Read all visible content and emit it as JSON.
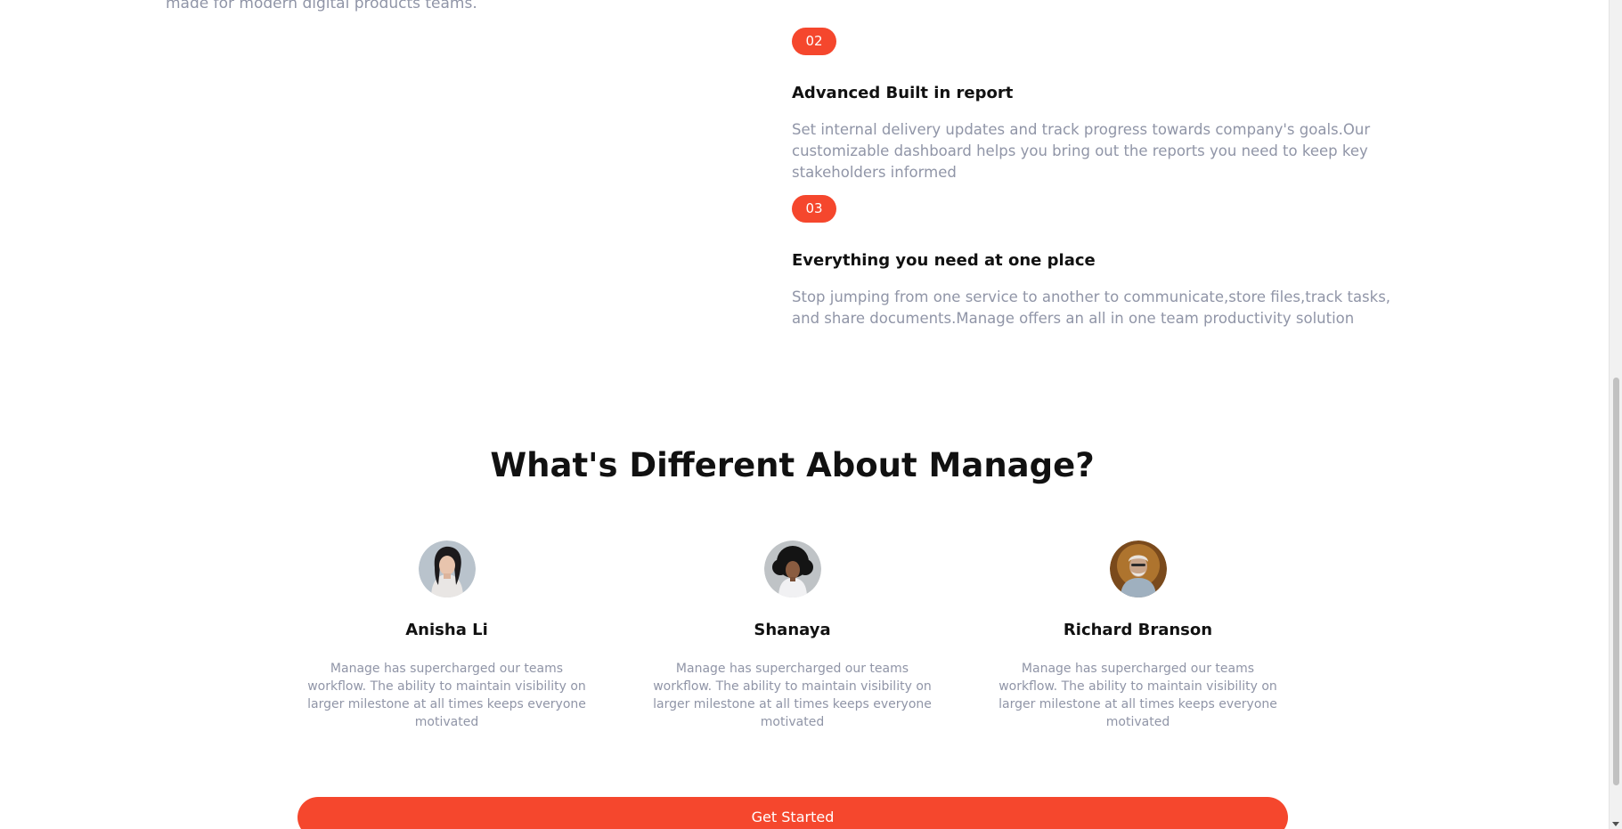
{
  "intro": {
    "tail_text": "made for modern digital products teams."
  },
  "features": [
    {
      "number": "02",
      "title": "Advanced Built in report",
      "text": "Set internal delivery updates and track progress towards company's goals.Our customizable dashboard helps you bring out the reports you need to keep key stakeholders informed"
    },
    {
      "number": "03",
      "title": "Everything you need at one place",
      "text": "Stop jumping from one service to another to communicate,store files,track tasks, and share documents.Manage offers an all in one team productivity solution"
    }
  ],
  "testimonials_section": {
    "title": "What's Different About Manage?",
    "items": [
      {
        "name": "Anisha Li",
        "quote": "Manage has supercharged our teams workflow. The ability to maintain visibility on larger milestone at all times keeps everyone motivated"
      },
      {
        "name": "Shanaya",
        "quote": "Manage has supercharged our teams workflow. The ability to maintain visibility on larger milestone at all times keeps everyone motivated"
      },
      {
        "name": "Richard Branson",
        "quote": "Manage has supercharged our teams workflow. The ability to maintain visibility on larger milestone at all times keeps everyone motivated"
      }
    ]
  },
  "cta": {
    "label": "Get Started"
  },
  "colors": {
    "accent": "#f5472d",
    "heading": "#111111",
    "body_text": "#9095a7"
  }
}
